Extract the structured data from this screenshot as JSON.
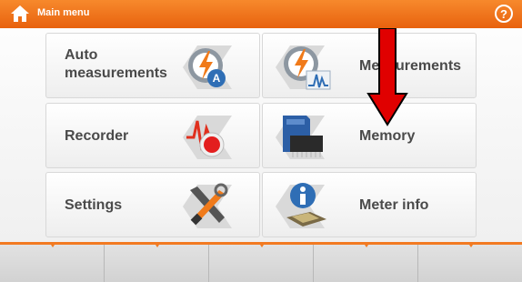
{
  "header": {
    "title": "Main menu",
    "home_icon": "home-icon",
    "help_label": "?",
    "bg_color": "#f07a22"
  },
  "tiles": [
    {
      "name": "auto-measurements",
      "label_line1": "Auto",
      "label_line2": "measurements",
      "icon": "auto-measurement-icon"
    },
    {
      "name": "measurements",
      "label": "Measurements",
      "icon": "measurements-icon"
    },
    {
      "name": "recorder",
      "label": "Recorder",
      "icon": "recorder-icon"
    },
    {
      "name": "memory",
      "label": "Memory",
      "icon": "memory-icon"
    },
    {
      "name": "settings",
      "label": "Settings",
      "icon": "settings-icon"
    },
    {
      "name": "meter-info",
      "label": "Meter info",
      "icon": "meter-info-icon"
    }
  ],
  "bottombar": {
    "softkeys": 5,
    "accent_color": "#f27a22"
  },
  "overlay": {
    "arrow": "red-down-arrow",
    "color": "#e00000"
  }
}
